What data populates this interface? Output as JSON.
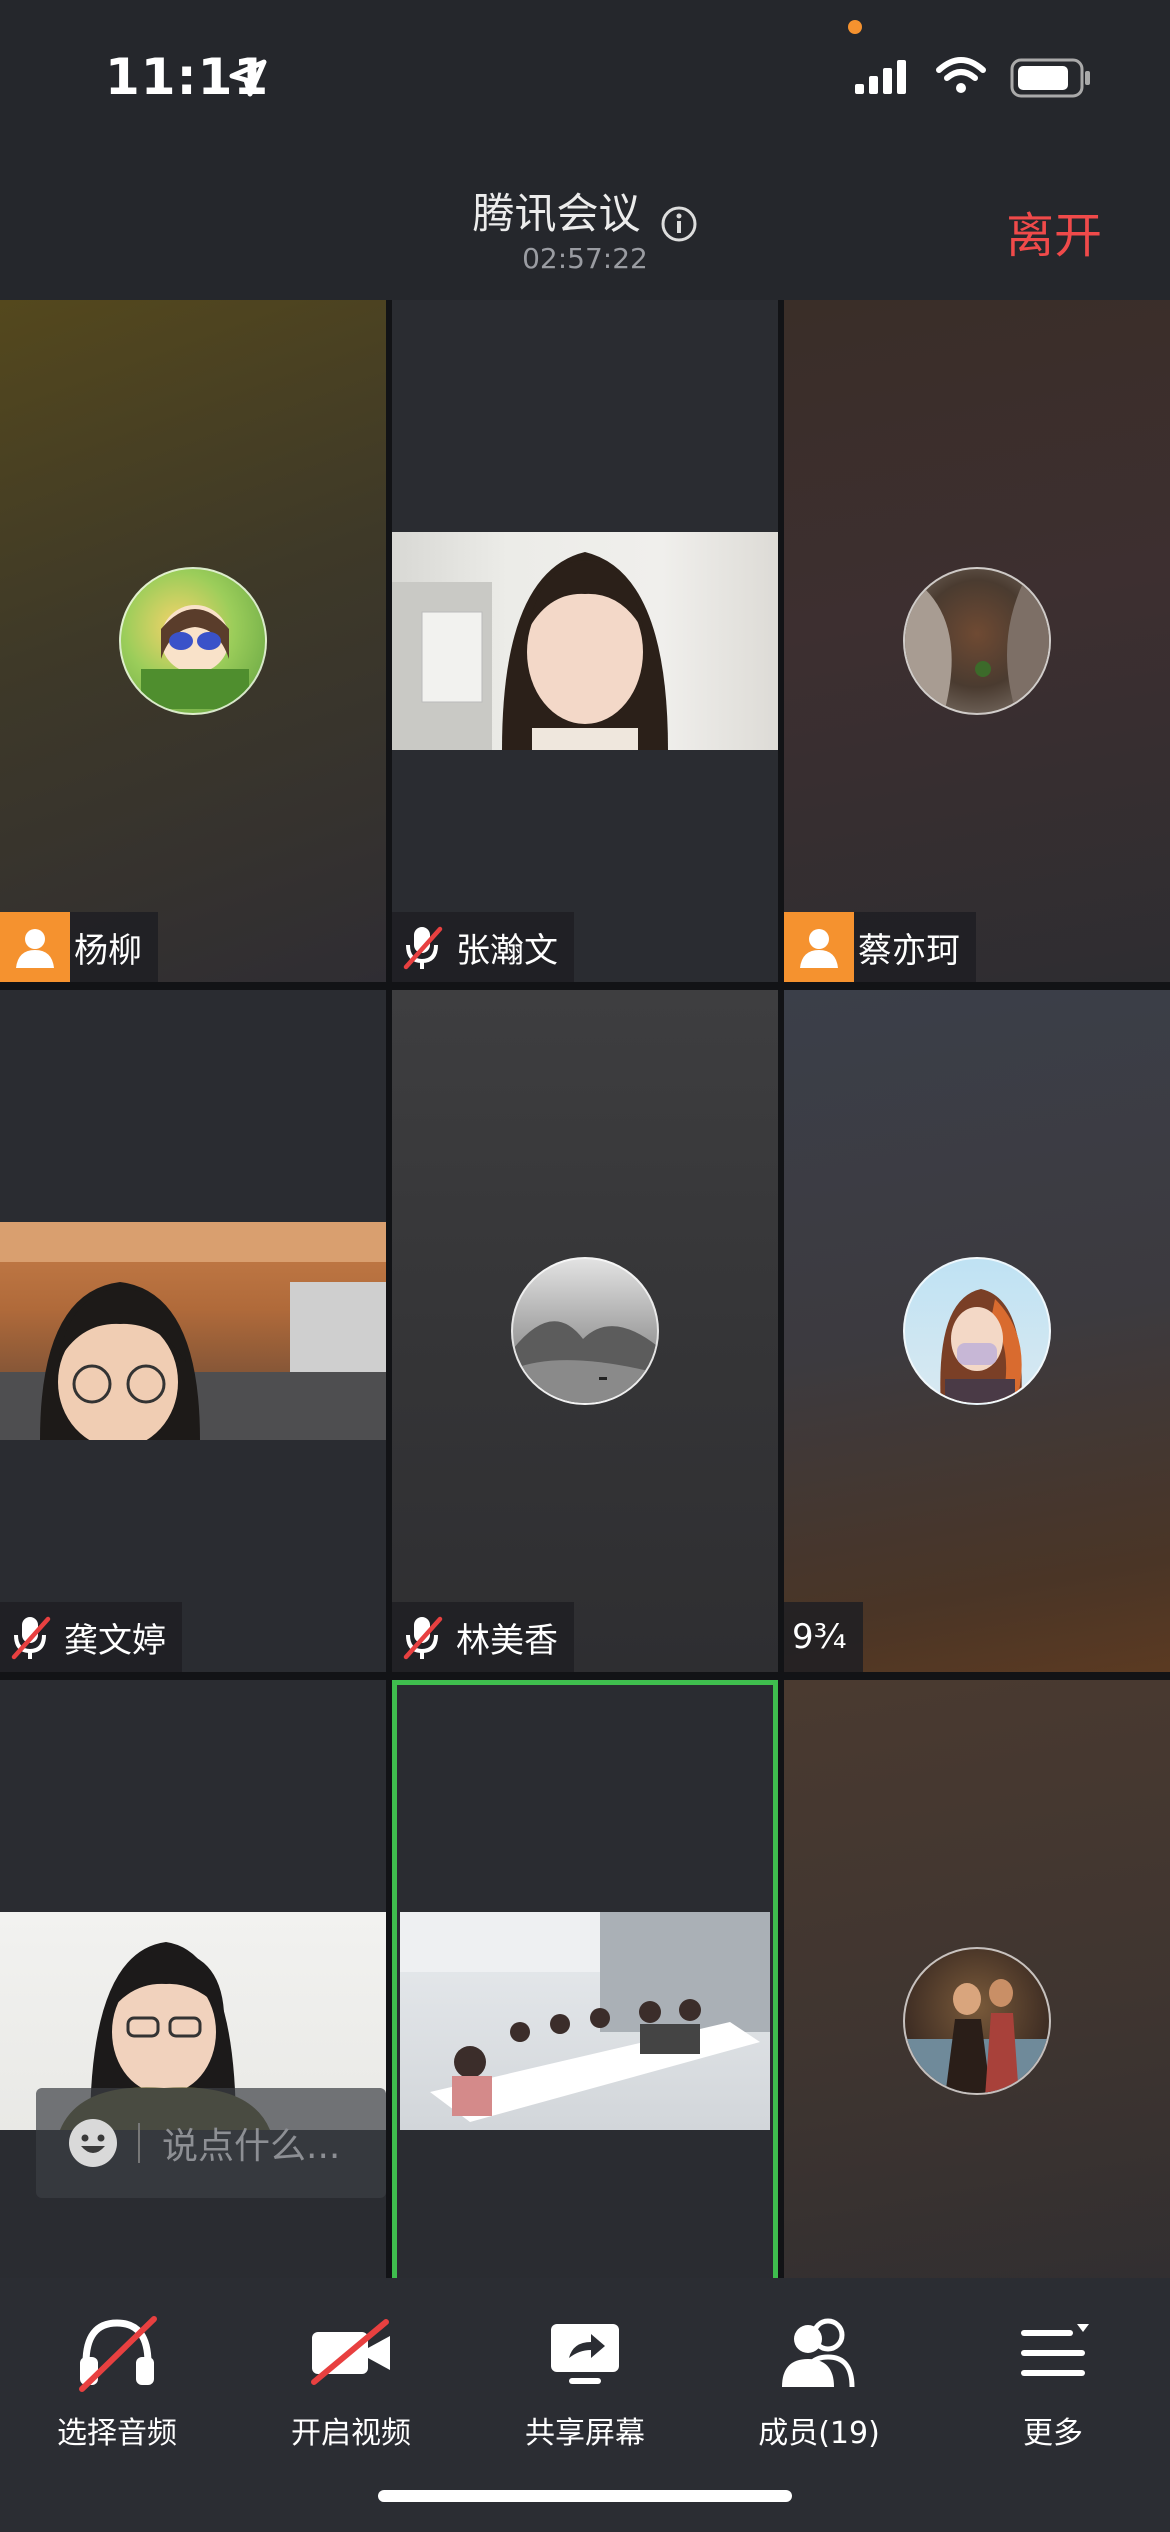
{
  "status_bar": {
    "time": "11:11",
    "colors": {
      "orange_dot": "#f5922f"
    }
  },
  "header": {
    "title": "腾讯会议",
    "duration": "02:57:22",
    "leave_label": "离开",
    "leave_color": "#f04a4a"
  },
  "tiles": [
    {
      "name": "杨柳",
      "indicator": "person-icon",
      "media": "avatar"
    },
    {
      "name": "张瀚文",
      "indicator": "mic-muted-icon",
      "media": "video"
    },
    {
      "name": "蔡亦珂",
      "indicator": "person-icon",
      "media": "avatar"
    },
    {
      "name": "龚文婷",
      "indicator": "mic-muted-icon",
      "media": "video"
    },
    {
      "name": "林美香",
      "indicator": "mic-muted-icon",
      "media": "avatar"
    },
    {
      "name": "9¾",
      "indicator": "none",
      "media": "avatar"
    },
    {
      "name": "",
      "indicator": "none",
      "media": "video"
    },
    {
      "name": "",
      "indicator": "none",
      "media": "video",
      "selected": true
    },
    {
      "name": "",
      "indicator": "none",
      "media": "avatar"
    }
  ],
  "chat": {
    "placeholder": "说点什么..."
  },
  "toolbar": {
    "audio": "选择音频",
    "video": "开启视频",
    "share": "共享屏幕",
    "members": "成员(19)",
    "more": "更多"
  },
  "colors": {
    "selected_border": "#3fbe4e",
    "badge_orange": "#f5922f",
    "mute_red": "#e84040"
  }
}
